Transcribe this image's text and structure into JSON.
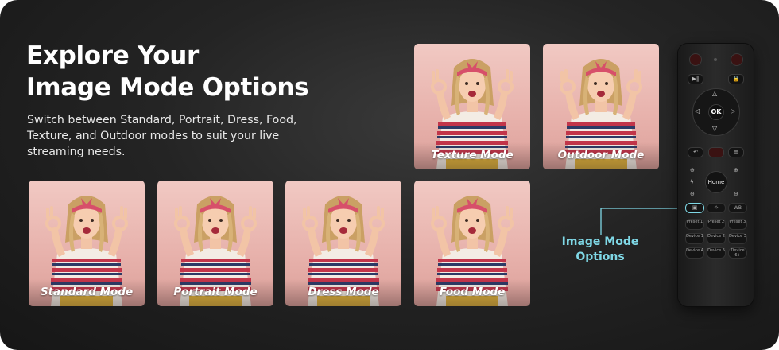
{
  "hero": {
    "title_line1": "Explore Your",
    "title_line2": "Image Mode Options",
    "description": "Switch between Standard, Portrait, Dress, Food, Texture, and Outdoor modes to suit your live streaming needs."
  },
  "modes": [
    {
      "label": "Texture Mode"
    },
    {
      "label": "Outdoor Mode"
    },
    {
      "label": "Standard Mode"
    },
    {
      "label": "Portrait Mode"
    },
    {
      "label": "Dress Mode"
    },
    {
      "label": "Food Mode"
    }
  ],
  "callout": {
    "line1": "Image Mode",
    "line2": "Options"
  },
  "remote": {
    "ok_label": "OK",
    "home_label": "Home",
    "wb_label": "WB",
    "buttons": [
      "Preset 1",
      "Preset 2",
      "Preset 3",
      "Device 1",
      "Device 2",
      "Device 3",
      "Device 4",
      "Device 5",
      "Device 6+"
    ]
  },
  "colors": {
    "accent": "#7fd8e6",
    "background": "#242424",
    "card": "#e7b1ab"
  }
}
